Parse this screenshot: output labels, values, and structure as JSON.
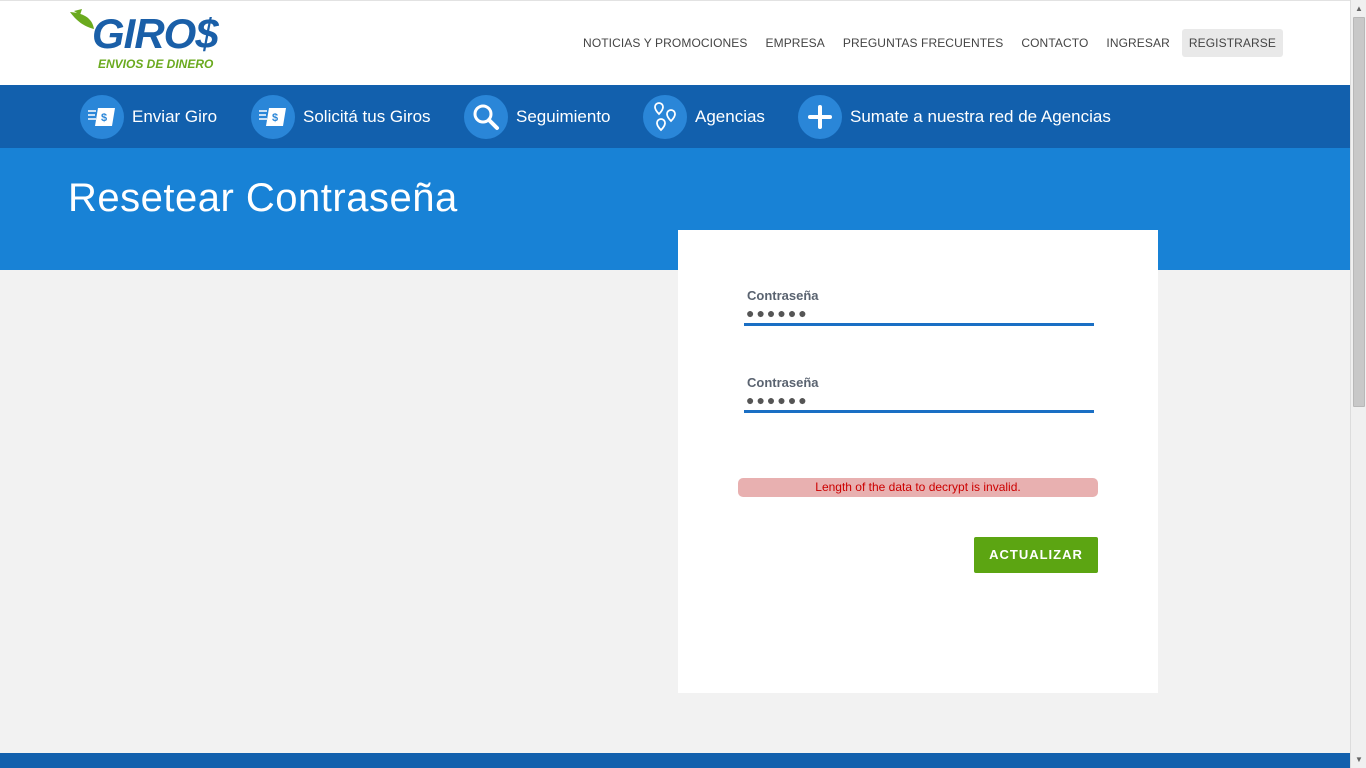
{
  "brand": {
    "name": "GIRO$",
    "tagline": "ENVIOS DE DINERO",
    "colors": {
      "blue": "#1a5fa8",
      "green": "#6aaa1e"
    }
  },
  "topnav": {
    "items": [
      {
        "label": "NOTICIAS Y PROMOCIONES"
      },
      {
        "label": "EMPRESA"
      },
      {
        "label": "PREGUNTAS FRECUENTES"
      },
      {
        "label": "CONTACTO"
      },
      {
        "label": "INGRESAR"
      },
      {
        "label": "REGISTRARSE"
      }
    ]
  },
  "mainnav": {
    "items": [
      {
        "label": "Enviar Giro",
        "icon": "money-transfer-icon"
      },
      {
        "label": "Solicitá tus Giros",
        "icon": "money-request-icon"
      },
      {
        "label": "Seguimiento",
        "icon": "search-icon"
      },
      {
        "label": "Agencias",
        "icon": "map-pin-icon"
      },
      {
        "label": "Sumate a nuestra red de Agencias",
        "icon": "plus-icon"
      }
    ]
  },
  "page": {
    "title": "Resetear Contraseña"
  },
  "form": {
    "password": {
      "label": "Contraseña",
      "value": "●●●●●●"
    },
    "confirm": {
      "label": "Contraseña",
      "value": "●●●●●●"
    },
    "error": "Length of the data to decrypt is invalid.",
    "submit_label": "ACTUALIZAR"
  },
  "colors": {
    "nav_blue": "#1260ad",
    "hero_blue": "#1882d6",
    "button_green": "#5ca512",
    "error_bg": "#e8b0b0",
    "error_text": "#cc0000"
  }
}
